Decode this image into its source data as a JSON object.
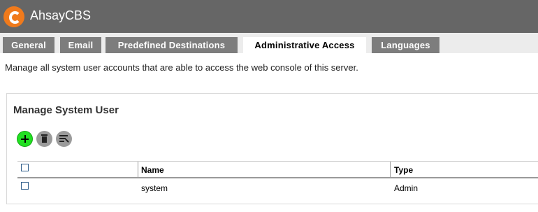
{
  "app": {
    "title": "AhsayCBS",
    "logo_icon": "ahsay-c-logo"
  },
  "tabs": [
    {
      "label": "General",
      "active": false
    },
    {
      "label": "Email",
      "active": false
    },
    {
      "label": "Predefined Destinations",
      "active": false
    },
    {
      "label": "Administrative Access",
      "active": true
    },
    {
      "label": "Languages",
      "active": false
    }
  ],
  "description": "Manage all system user accounts that are able to access the web console of this server.",
  "panel": {
    "title": "Manage System User",
    "toolbar": [
      {
        "icon": "add-icon",
        "color": "#22e022"
      },
      {
        "icon": "delete-icon",
        "color": "#9b9b9b"
      },
      {
        "icon": "filter-icon",
        "color": "#9b9b9b"
      }
    ],
    "table": {
      "columns": [
        "Name",
        "Type"
      ],
      "rows": [
        {
          "name": "system",
          "type": "Admin",
          "checked": false
        }
      ]
    }
  },
  "colors": {
    "titlebar": "#666666",
    "tab_inactive": "#7d7d7d",
    "logo": "#f07a1c"
  }
}
